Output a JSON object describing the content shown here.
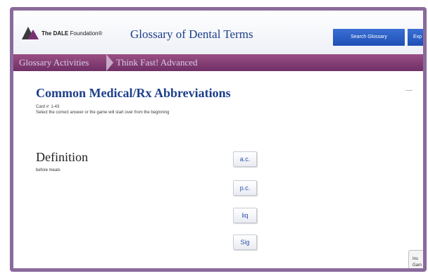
{
  "header": {
    "logo_text_bold": "The DALE",
    "logo_text_rest": " Foundation®",
    "title": "Glossary of Dental Terms",
    "search_button": "Search Glossary",
    "extra_button": "Exp"
  },
  "breadcrumb": {
    "items": [
      "Glossary Activities",
      "Think Fast! Advanced"
    ]
  },
  "main": {
    "title": "Common Medical/Rx Abbreviations",
    "card_label": "Card #: 1-43",
    "instructions": "Select the correct answer or the game will start over from the beginning",
    "definition_heading": "Definition",
    "definition_text": "before meals"
  },
  "answers": [
    "a.c.",
    "p.c.",
    "liq",
    "Sig"
  ],
  "corner": {
    "line1": "Ins",
    "line2": "Gam"
  },
  "colors": {
    "accent_blue": "#1d3f8a",
    "breadcrumb_purple": "#7f3a73",
    "button_blue": "#2a5cc6"
  }
}
